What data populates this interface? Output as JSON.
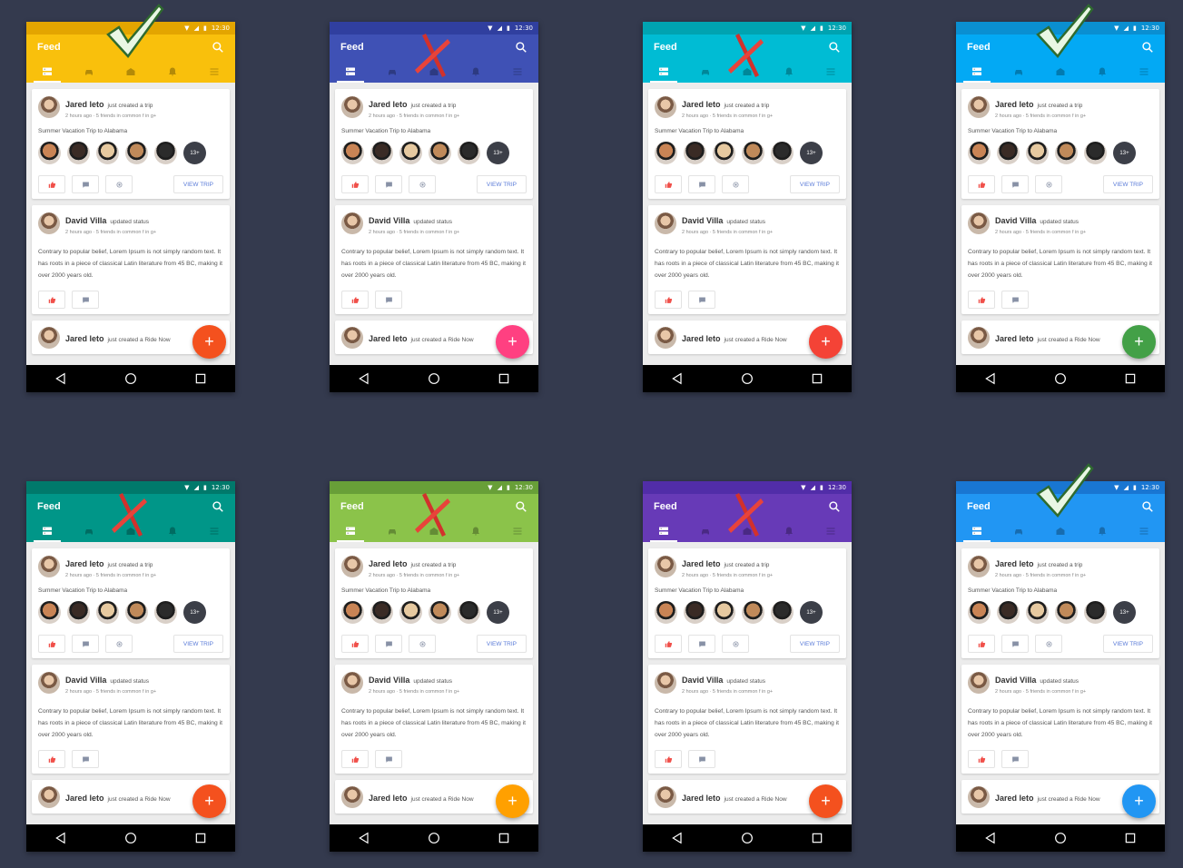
{
  "feed": {
    "title": "Feed",
    "status_time": "12:30",
    "post1": {
      "name": "Jared leto",
      "action": "just created a trip",
      "meta": "2 hours ago · 5 friends in common   f  in  g+",
      "trip_title": "Summer Vacation Trip to Alabama",
      "more_count": "13+",
      "view_trip": "VIEW TRIP"
    },
    "post2": {
      "name": "David Villa",
      "action": "updated status",
      "meta": "2 hours ago · 5 friends in common   f  in  g+",
      "text": "Contrary to popular belief, Lorem Ipsum is not simply random text. It has roots in a piece of classical Latin literature from 45 BC, making it over 2000 years old."
    },
    "post3": {
      "name": "Jared leto",
      "action": "just created a Ride Now"
    },
    "fab_label": "+"
  },
  "icons": {
    "tabs": [
      "feed-icon",
      "car-icon",
      "mail-icon",
      "bell-icon",
      "menu-icon"
    ],
    "nav": [
      "back-icon",
      "home-icon",
      "recent-apps-icon"
    ]
  },
  "variants": [
    {
      "status": "#e3a500",
      "bar": "#f9c00c",
      "fab": "#f4511e",
      "verdict": "approved"
    },
    {
      "status": "#303f9f",
      "bar": "#3f51b5",
      "fab": "#ff4081",
      "verdict": "rejected"
    },
    {
      "status": "#00a3b1",
      "bar": "#00bcd4",
      "fab": "#f44336",
      "verdict": "rejected"
    },
    {
      "status": "#0a8fd1",
      "bar": "#03a9f4",
      "fab": "#43a047",
      "verdict": "approved"
    },
    {
      "status": "#00796b",
      "bar": "#009688",
      "fab": "#f4511e",
      "verdict": "rejected"
    },
    {
      "status": "#689f38",
      "bar": "#8bc34a",
      "fab": "#ffa000",
      "verdict": "rejected"
    },
    {
      "status": "#512da8",
      "bar": "#673ab7",
      "fab": "#f4511e",
      "verdict": "rejected"
    },
    {
      "status": "#1976d2",
      "bar": "#2196f3",
      "fab": "#2196f3",
      "verdict": "approved"
    }
  ],
  "friend_colors": [
    "#c98455",
    "#3a2b25",
    "#e6c9a0",
    "#c08a5a",
    "#2b2b2b"
  ]
}
